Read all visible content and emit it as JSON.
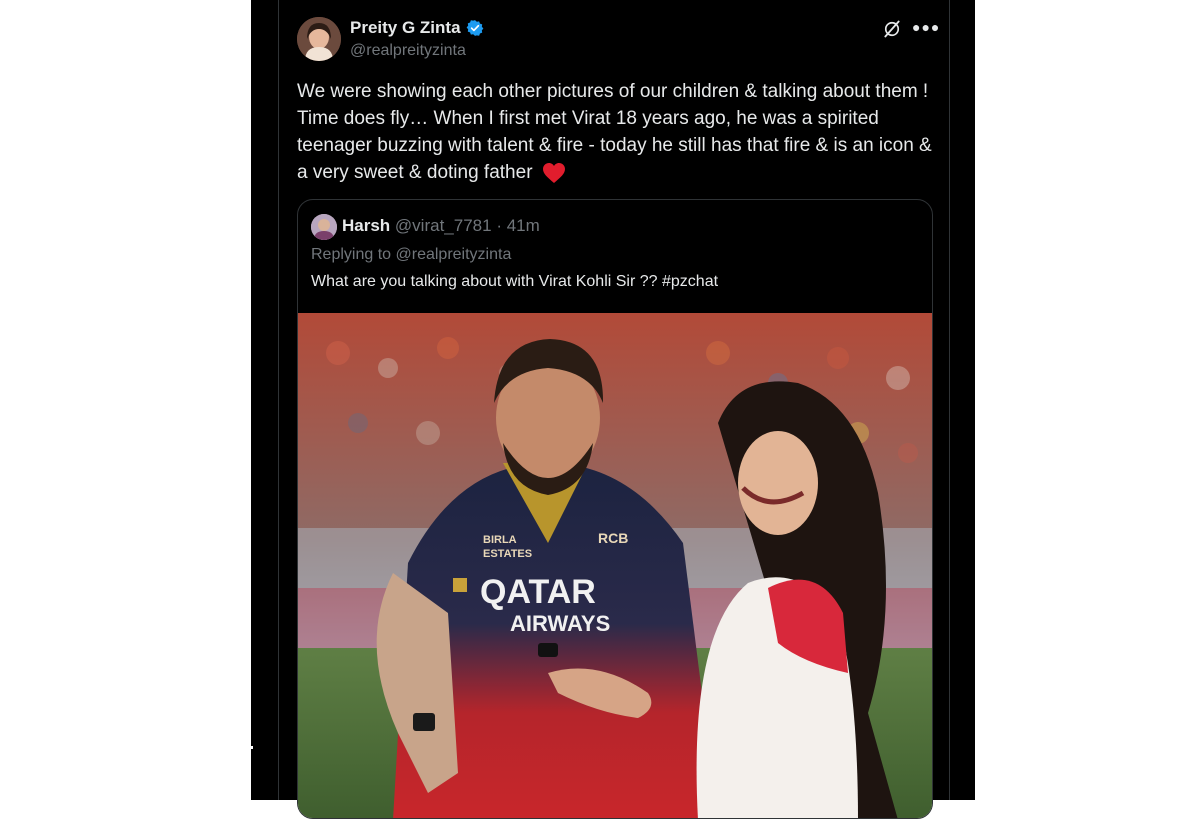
{
  "tweet": {
    "author_name": "Preity G Zinta",
    "author_handle": "@realpreityzinta",
    "verified_icon": "verified-badge-icon",
    "text": "We were showing each other pictures of our children & talking about them ! Time does fly… When I first met Virat 18 years ago, he was a spirited teenager buzzing with talent & fire - today he still has that fire & is an icon & a very sweet & doting father",
    "emoji": "heart-emoji",
    "actions": {
      "grok": "grok-icon",
      "more": "more-icon"
    }
  },
  "quote": {
    "author_name": "Harsh",
    "author_handle": "@virat_7781",
    "separator": "·",
    "time": "41m",
    "replying_to": "Replying to @realpreityzinta",
    "text": "What are you talking about with Virat Kohli Sir ?? #pzchat",
    "photo": {
      "jersey_sponsor_line1": "QATAR",
      "jersey_sponsor_line2": "AIRWAYS",
      "jersey_badge_line1": "BIRLA",
      "jersey_badge_line2": "ESTATES",
      "jersey_logo": "RCB"
    }
  },
  "colors": {
    "background": "#000000",
    "text": "#e7e9ea",
    "muted": "#71767b",
    "verified": "#1d9bf0",
    "heart": "#f91880"
  }
}
